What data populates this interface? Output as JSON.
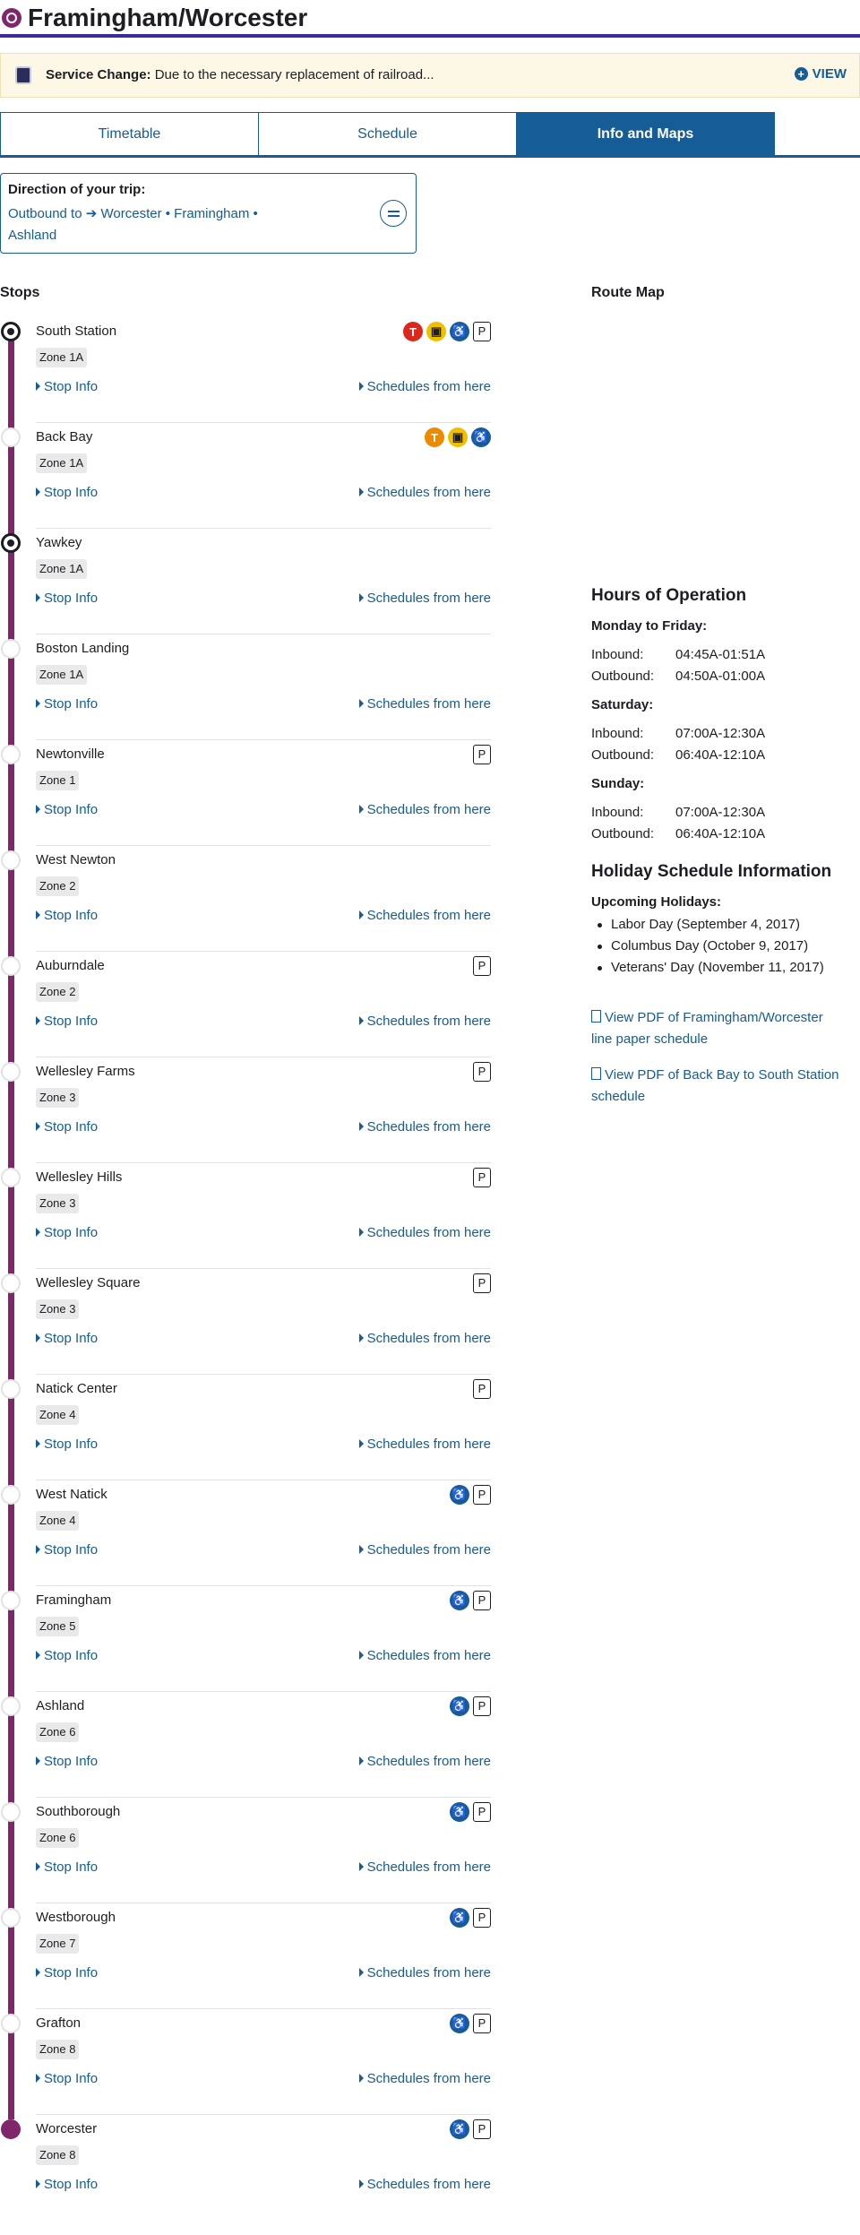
{
  "header": {
    "title": "Framingham/Worcester",
    "icon": "commuter-rail-icon"
  },
  "alert": {
    "prefix": "Service Change:",
    "text": "Due to the necessary replacement of railroad...",
    "view_label": "VIEW"
  },
  "tabs": [
    {
      "label": "Timetable"
    },
    {
      "label": "Schedule"
    },
    {
      "label": "Info and Maps",
      "active": true
    }
  ],
  "direction": {
    "label": "Direction of your trip:",
    "route_prefix": "Outbound to",
    "route_stops": "Worcester • Framingham •",
    "route_stops_2": "Ashland"
  },
  "stops_heading": "Stops",
  "route_map_heading": "Route Map",
  "stop_info_label": "Stop Info",
  "schedules_label": "Schedules from here",
  "stops": [
    {
      "name": "South Station",
      "zone": "Zone 1A",
      "icons": [
        "red-line-icon",
        "silver-line-icon",
        "accessible-icon",
        "parking-icon"
      ]
    },
    {
      "name": "Back Bay",
      "zone": "Zone 1A",
      "icons": [
        "orange-line-icon",
        "silver-line-icon",
        "accessible-icon"
      ]
    },
    {
      "name": "Yawkey",
      "zone": "Zone 1A",
      "icons": []
    },
    {
      "name": "Boston Landing",
      "zone": "Zone 1A",
      "icons": []
    },
    {
      "name": "Newtonville",
      "zone": "Zone 1",
      "icons": [
        "parking-icon"
      ]
    },
    {
      "name": "West Newton",
      "zone": "Zone 2",
      "icons": []
    },
    {
      "name": "Auburndale",
      "zone": "Zone 2",
      "icons": [
        "parking-icon"
      ]
    },
    {
      "name": "Wellesley Farms",
      "zone": "Zone 3",
      "icons": [
        "parking-icon"
      ]
    },
    {
      "name": "Wellesley Hills",
      "zone": "Zone 3",
      "icons": [
        "parking-icon"
      ]
    },
    {
      "name": "Wellesley Square",
      "zone": "Zone 3",
      "icons": [
        "parking-icon"
      ]
    },
    {
      "name": "Natick Center",
      "zone": "Zone 4",
      "icons": [
        "parking-icon"
      ]
    },
    {
      "name": "West Natick",
      "zone": "Zone 4",
      "icons": [
        "accessible-icon",
        "parking-icon"
      ]
    },
    {
      "name": "Framingham",
      "zone": "Zone 5",
      "icons": [
        "accessible-icon",
        "parking-icon"
      ]
    },
    {
      "name": "Ashland",
      "zone": "Zone 6",
      "icons": [
        "accessible-icon",
        "parking-icon"
      ]
    },
    {
      "name": "Southborough",
      "zone": "Zone 6",
      "icons": [
        "accessible-icon",
        "parking-icon"
      ]
    },
    {
      "name": "Westborough",
      "zone": "Zone 7",
      "icons": [
        "accessible-icon",
        "parking-icon"
      ]
    },
    {
      "name": "Grafton",
      "zone": "Zone 8",
      "icons": [
        "accessible-icon",
        "parking-icon"
      ]
    },
    {
      "name": "Worcester",
      "zone": "Zone 8",
      "icons": [
        "accessible-icon",
        "parking-icon"
      ]
    }
  ],
  "hours": {
    "title": "Hours of Operation",
    "days": [
      {
        "label": "Monday to Friday:",
        "inbound": "04:45A-01:51A",
        "outbound": "04:50A-01:00A"
      },
      {
        "label": "Saturday:",
        "inbound": "07:00A-12:30A",
        "outbound": "06:40A-12:10A"
      },
      {
        "label": "Sunday:",
        "inbound": "07:00A-12:30A",
        "outbound": "06:40A-12:10A"
      }
    ],
    "inbound_label": "Inbound:",
    "outbound_label": "Outbound:"
  },
  "holidays": {
    "title": "Holiday Schedule Information",
    "subtitle": "Upcoming Holidays:",
    "items": [
      "Labor Day (September 4, 2017)",
      "Columbus Day (October 9, 2017)",
      "Veterans' Day (November 11, 2017)"
    ]
  },
  "pdfs": [
    {
      "line1": "View PDF of Framingham/Worcester",
      "line2": "line paper schedule"
    },
    {
      "line1": "View PDF of Back Bay to South Station",
      "line2": "schedule"
    }
  ],
  "colors": {
    "line": "#80276c",
    "link": "#165c96",
    "header_rule": "#3b2b9b"
  }
}
